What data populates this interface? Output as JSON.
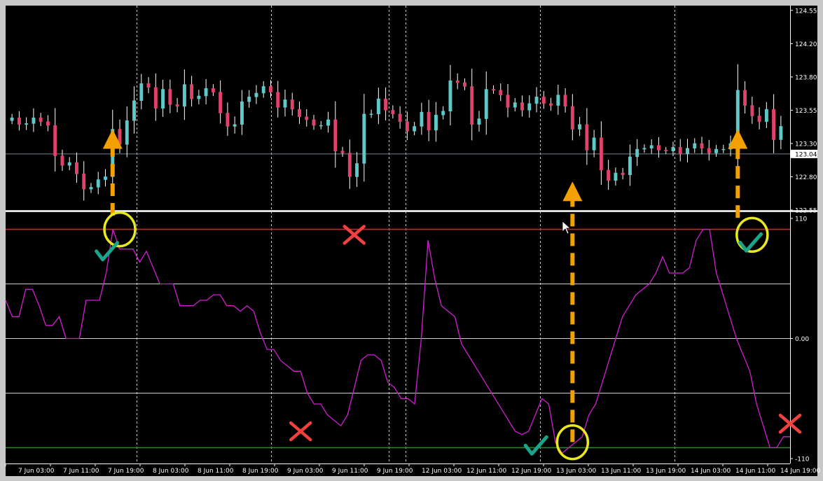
{
  "colors": {
    "background": "#000000",
    "frame": "#c8c8c8",
    "grid_vertical": "#c8c8c8",
    "bull_candle": "#5ec9c9",
    "bear_candle": "#e0426b",
    "cci_line": "#d21dd2",
    "level_upper": "#e11c1c",
    "level_lower": "#1f8a1f",
    "level_mid": "#d0d0d0",
    "price_line": "#708090",
    "arrow": "#f4a000",
    "circle": "#e8e81e",
    "check": "#1aa58a",
    "cross": "#f04040"
  },
  "chart_data": [
    {
      "type": "candlestick",
      "title": "",
      "ylim": [
        122.45,
        124.6
      ],
      "yticks": [
        "124.55",
        "124.20",
        "123.80",
        "123.55",
        "123.30",
        "123.04",
        "122.80",
        "122.55"
      ],
      "ytick_values": [
        124.55,
        124.2,
        123.85,
        123.5,
        123.15,
        123.04,
        122.8,
        122.45
      ],
      "current_price": "123.04",
      "current_price_value": 123.04,
      "bar_count": 108,
      "closes": [
        123.42,
        123.35,
        123.36,
        123.42,
        123.38,
        123.34,
        123.02,
        122.92,
        122.95,
        122.83,
        122.67,
        122.69,
        122.77,
        122.8,
        123.3,
        123.14,
        123.39,
        123.6,
        123.78,
        123.74,
        123.52,
        123.72,
        123.56,
        123.54,
        123.77,
        123.62,
        123.65,
        123.73,
        123.69,
        123.47,
        123.33,
        123.35,
        123.59,
        123.64,
        123.68,
        123.75,
        123.69,
        123.53,
        123.61,
        123.51,
        123.43,
        123.4,
        123.34,
        123.34,
        123.4,
        123.07,
        123.05,
        122.8,
        122.94,
        123.46,
        123.46,
        123.62,
        123.5,
        123.46,
        123.38,
        123.28,
        123.33,
        123.48,
        123.29,
        123.45,
        123.49,
        123.81,
        123.79,
        123.75,
        123.35,
        123.41,
        123.72,
        123.71,
        123.66,
        123.53,
        123.58,
        123.5,
        123.57,
        123.64,
        123.57,
        123.55,
        123.66,
        123.54,
        123.3,
        123.35,
        123.08,
        123.21,
        122.87,
        122.76,
        122.84,
        122.82,
        123.01,
        123.09,
        123.1,
        123.13,
        123.08,
        123.07,
        123.11,
        123.04,
        123.1,
        123.15,
        123.1,
        123.05,
        123.09,
        123.09,
        123.15,
        123.71,
        123.55,
        123.44,
        123.38,
        123.51,
        123.19,
        123.33
      ]
    },
    {
      "type": "line",
      "name": "",
      "ylim": [
        -110,
        110
      ],
      "yticks": [
        "110",
        "0.00",
        "-110"
      ],
      "ytick_values": [
        110,
        0,
        -110
      ],
      "levels": [
        100,
        50,
        0,
        -50,
        -100
      ],
      "values": [
        35,
        20,
        20,
        45,
        45,
        30,
        12,
        12,
        20,
        0,
        0,
        0,
        35,
        35,
        35,
        60,
        100,
        82,
        82,
        82,
        70,
        80,
        65,
        50,
        50,
        50,
        30,
        30,
        30,
        35,
        35,
        40,
        40,
        30,
        30,
        25,
        30,
        25,
        5,
        -10,
        -10,
        -20,
        -25,
        -30,
        -30,
        -50,
        -60,
        -60,
        -70,
        -75,
        -80,
        -70,
        -45,
        -20,
        -15,
        -15,
        -20,
        -40,
        -45,
        -55,
        -55,
        -60,
        0,
        90,
        55,
        30,
        25,
        20,
        -5,
        -15,
        -25,
        -35,
        -45,
        -55,
        -65,
        -75,
        -85,
        -88,
        -85,
        -70,
        -55,
        -60,
        -95,
        -105,
        -100,
        -95,
        -90,
        -70,
        -60,
        -40,
        -20,
        0,
        20,
        30,
        40,
        45,
        50,
        60,
        75,
        60,
        60,
        60,
        65,
        90,
        100,
        100,
        60,
        40,
        20,
        0,
        -15,
        -30,
        -60,
        -80,
        -100,
        -100,
        -90,
        -90
      ]
    }
  ],
  "x_axis_labels": [
    "7 Jun 03:00",
    "7 Jun 11:00",
    "7 Jun 19:00",
    "8 Jun 03:00",
    "8 Jun 11:00",
    "8 Jun 19:00",
    "9 Jun 03:00",
    "9 Jun 11:00",
    "9 Jun 19:00",
    "12 Jun 03:00",
    "12 Jun 11:00",
    "12 Jun 19:00",
    "13 Jun 03:00",
    "13 Jun 11:00",
    "13 Jun 19:00",
    "14 Jun 03:00",
    "14 Jun 11:00",
    "14 Jun 19:00"
  ],
  "annotations": {
    "arrows": [
      {
        "direction": "up",
        "from_bar": 14,
        "from_value": 110,
        "to_value": 123.3
      },
      {
        "direction": "up",
        "from_bar": 78,
        "from_value": -100,
        "to_value": 122.75
      },
      {
        "direction": "up",
        "from_bar": 101,
        "from_value": 108,
        "to_value": 123.3
      }
    ],
    "circles": [
      {
        "bar": 15,
        "value": 100
      },
      {
        "bar": 78,
        "value": -95
      },
      {
        "bar": 103,
        "value": 95
      }
    ],
    "checks": [
      {
        "bar": 15,
        "value": 80
      },
      {
        "bar": 79,
        "value": -98
      },
      {
        "bar": 111,
        "value": 88
      }
    ],
    "crosses": [
      {
        "bar": 52,
        "value": 95
      },
      {
        "bar": 44,
        "value": -85
      },
      {
        "bar": 117,
        "value": -78
      }
    ]
  }
}
